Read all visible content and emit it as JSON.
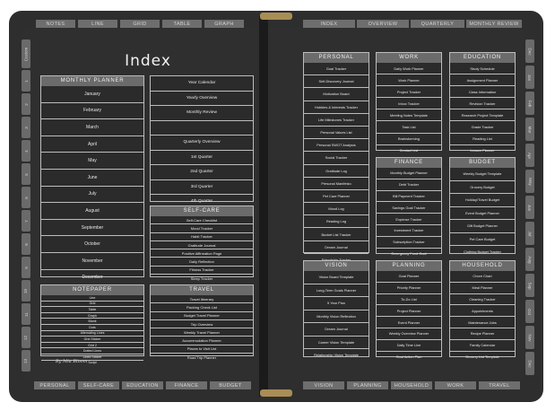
{
  "top_tabs_left": [
    "Notes",
    "Line",
    "Grid",
    "Table",
    "Graph"
  ],
  "top_tabs_right": [
    "Index",
    "Overview",
    "Quarterly",
    "Monthly Review"
  ],
  "bottom_tabs_left": [
    "Personal",
    "Self-Care",
    "Education",
    "Finance",
    "Budget"
  ],
  "bottom_tabs_right": [
    "Vision",
    "Planning",
    "Household",
    "Work",
    "Travel"
  ],
  "left_side_tabs": [
    "Custom",
    "1",
    "2",
    "3",
    "4",
    "5",
    "6",
    "7",
    "8",
    "9",
    "10",
    "11",
    "12",
    "13"
  ],
  "right_side_tabs": [
    "Dec",
    "Jan",
    "Feb",
    "Mar",
    "Apr",
    "May",
    "Jun",
    "Jul",
    "Aug",
    "Sep",
    "Oct",
    "Nov",
    "Dec"
  ],
  "index_title": "Index",
  "signature": "By Mia Bloom",
  "monthly_planner": {
    "title": "Monthly Planner",
    "items": [
      "January",
      "February",
      "March",
      "April",
      "May",
      "June",
      "July",
      "August",
      "September",
      "October",
      "November",
      "December"
    ]
  },
  "year_list": {
    "items": [
      "Year Calendar",
      "Yearly Overview",
      "Monthly Review",
      "",
      "Quarterly Overview",
      "1st Quarter",
      "2nd Quarter",
      "3rd Quarter",
      "4th Quarter"
    ]
  },
  "self_care": {
    "title": "Self-Care",
    "items": [
      "Self-Care Checklist",
      "Mood Tracker",
      "Habit Tracker",
      "Gratitude Journal",
      "Positive Affirmation Page",
      "Daily Reflection",
      "Fitness Tracker",
      "Sleep Tracker"
    ]
  },
  "notepaper": {
    "title": "Notepaper",
    "items": [
      "Line",
      "Grid",
      "Table",
      "Graph",
      "Blank",
      "Dots",
      "Alternating Lines",
      "Grid Sticker",
      "Grid 2",
      "Dotted Lines",
      "Lined Sticker",
      "Script"
    ]
  },
  "travel": {
    "title": "Travel",
    "items": [
      "Travel Itinerary",
      "Packing Check List",
      "Budget Travel Planner",
      "Trip Overview",
      "Weekly Travel Planner",
      "Accommodation Planner",
      "Places to Visit List",
      "Road Trip Planner"
    ]
  },
  "personal": {
    "title": "Personal",
    "items": [
      "Goal Tracker",
      "Self-Discovery Journal",
      "Motivation Board",
      "Hobbies & Interests Tracker",
      "Life Milestones Tracker",
      "Personal Values List",
      "Personal SWOT Analysis",
      "Social Tracker",
      "Gratitude Log",
      "Personal Manifesto",
      "Pet Care Planner",
      "Mood Log",
      "Reading Log",
      "Bucket List Tracker",
      "Dream Journal",
      "Friendship Tracker"
    ]
  },
  "work": {
    "title": "Work",
    "items": [
      "Daily Work Planner",
      "Work Planner",
      "Project Tracker",
      "Inbox Tracker",
      "Meeting Notes Template",
      "Task List",
      "Brainstorming",
      "Contact List"
    ]
  },
  "education": {
    "title": "Education",
    "items": [
      "Study Schedule",
      "Assignment Planner",
      "Class Information",
      "Revision Tracker",
      "Research Project Template",
      "Grade Tracker",
      "Reading List",
      "Lesson Planner"
    ]
  },
  "finance": {
    "title": "Finance",
    "items": [
      "Monthly Budget Planner",
      "Debt Tracker",
      "Bill Payment Tracker",
      "Savings Goal Tracker",
      "Expense Tracker",
      "Investment Tracker",
      "Subscription Tracker",
      "Emergency Fund Goal"
    ]
  },
  "budget": {
    "title": "Budget",
    "items": [
      "Weekly Budget Template",
      "Grocery Budget",
      "Holiday/Travel Budget",
      "Event Budget Planner",
      "Gift Budget Planner",
      "Pet Care Budget",
      "Clothing Budget Tracker"
    ]
  },
  "vision": {
    "title": "Vision",
    "items": [
      "Vision Board Template",
      "Long-Term Goals Planner",
      "5 Year Plan",
      "Monthly Vision Reflection",
      "Dream Journal",
      "Career Vision Template",
      "Relationship Vision Template"
    ]
  },
  "planning": {
    "title": "Planning",
    "items": [
      "Goal Planner",
      "Priority Planner",
      "To-Do List",
      "Project Planner",
      "Event Planner",
      "Weekly Overview Planner",
      "Daily Time Line",
      "Goal Action Plan"
    ]
  },
  "household": {
    "title": "Household",
    "items": [
      "Chore Chart",
      "Meal Planner",
      "Cleaning Tracker",
      "Appointments",
      "Maintenance Jobs",
      "Recipe Planner",
      "Family Calendar",
      "Grocery List Template"
    ]
  },
  "colors": {
    "cover": "#2e2e2e",
    "page": "#2f2f2f",
    "tab": "#6e6e6e",
    "header": "#6b6b6b",
    "ring": "#a88d55"
  }
}
